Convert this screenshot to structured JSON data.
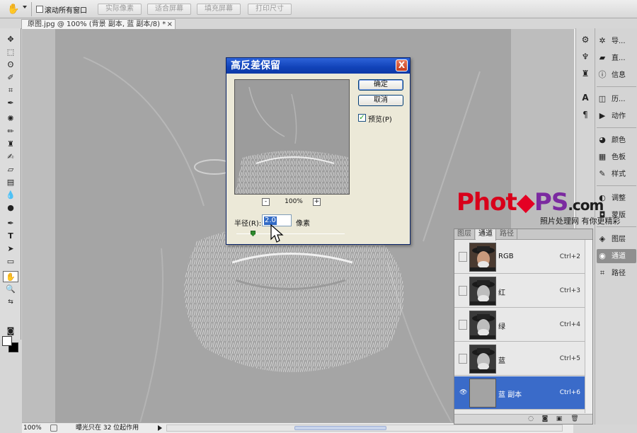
{
  "options_bar": {
    "scroll_all_label": "滚动所有窗口",
    "buttons": [
      "实际像素",
      "适合屏幕",
      "填充屏幕",
      "打印尺寸"
    ]
  },
  "document": {
    "tab_title": "原图.jpg @ 100% (背景 副本, 蓝 副本/8) *",
    "tab_close": "×"
  },
  "status_bar": {
    "zoom": "100%",
    "message": "曝光只在 32 位起作用"
  },
  "dialog": {
    "title": "高反差保留",
    "close": "X",
    "ok_label": "确定",
    "cancel_label": "取消",
    "preview_label": "预览(P)",
    "preview_checked": true,
    "zoom_minus": "-",
    "zoom_plus": "+",
    "zoom_percent": "100%",
    "radius_label": "半径(R):",
    "radius_value": "2.0",
    "radius_unit": "像素",
    "slider_position": 0.15
  },
  "dock_wide": {
    "items": [
      {
        "icon": "navigator-icon",
        "glyph": "✲",
        "label": "导..."
      },
      {
        "icon": "histogram-icon",
        "glyph": "▰",
        "label": "直..."
      },
      {
        "icon": "info-icon",
        "glyph": "ⓘ",
        "label": "信息"
      },
      {
        "icon": "history-icon",
        "glyph": "◫",
        "label": "历..."
      },
      {
        "icon": "actions-icon",
        "glyph": "▶",
        "label": "动作"
      },
      {
        "icon": "color-icon",
        "glyph": "◕",
        "label": "颜色"
      },
      {
        "icon": "swatches-icon",
        "glyph": "▦",
        "label": "色板"
      },
      {
        "icon": "styles-icon",
        "glyph": "✎",
        "label": "样式"
      },
      {
        "icon": "adjustments-icon",
        "glyph": "◐",
        "label": "调整"
      },
      {
        "icon": "masks-icon",
        "glyph": "◘",
        "label": "蒙版"
      },
      {
        "icon": "layers-icon",
        "glyph": "◈",
        "label": "图层"
      },
      {
        "icon": "channels-icon",
        "glyph": "◉",
        "label": "通道"
      },
      {
        "icon": "paths-icon",
        "glyph": "⌗",
        "label": "路径"
      }
    ],
    "active_index": 11
  },
  "channels_panel": {
    "tabs": [
      "图层",
      "通道",
      "路径"
    ],
    "active_tab": 1,
    "rows": [
      {
        "name": "RGB",
        "shortcut": "Ctrl+2",
        "visible": false,
        "tone": "color"
      },
      {
        "name": "红",
        "shortcut": "Ctrl+3",
        "visible": false,
        "tone": "gray"
      },
      {
        "name": "绿",
        "shortcut": "Ctrl+4",
        "visible": false,
        "tone": "gray"
      },
      {
        "name": "蓝",
        "shortcut": "Ctrl+5",
        "visible": false,
        "tone": "gray"
      },
      {
        "name": "蓝 副本",
        "shortcut": "Ctrl+6",
        "visible": true,
        "tone": "flat"
      }
    ],
    "selected_index": 4
  },
  "watermark": {
    "logo_part1": "Phot",
    "logo_part2": "PS",
    "logo_part3": ".com",
    "tagline": "照片处理网 有你更精彩"
  },
  "colors": {
    "selection_blue": "#3a6bc9",
    "title_blue": "#1142b8",
    "logo_red": "#d8001a",
    "logo_purple": "#7b2aa0"
  }
}
